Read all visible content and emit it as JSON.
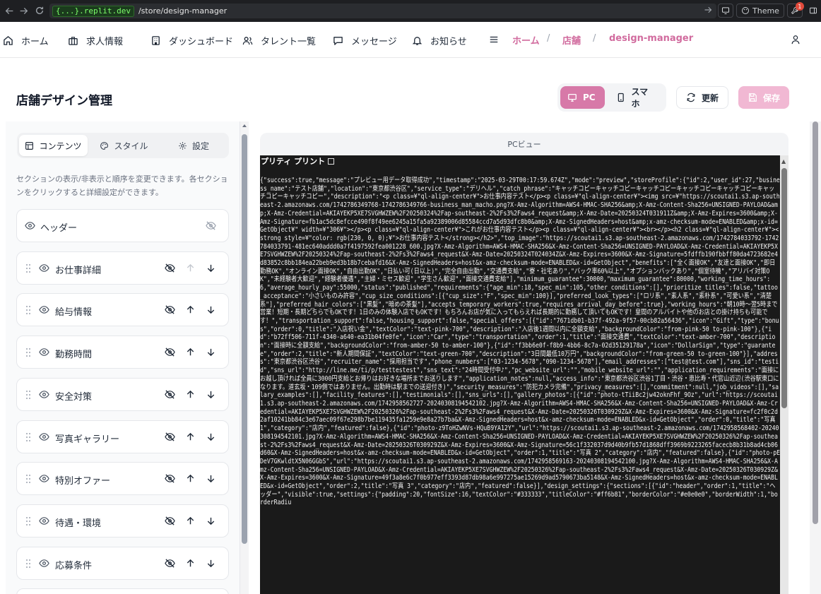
{
  "browser": {
    "replit_domain": "{...}.replit.dev",
    "path": "/store/design-manager",
    "theme_label": "Theme",
    "notification_count": "1"
  },
  "nav": {
    "items": [
      {
        "label": "ホーム",
        "icon": "home-icon"
      },
      {
        "label": "求人情報",
        "icon": "briefcase-icon"
      },
      {
        "label": "ダッシュボード",
        "icon": "building-icon"
      },
      {
        "label": "タレント一覧",
        "icon": "users-icon"
      },
      {
        "label": "メッセージ",
        "icon": "message-icon"
      },
      {
        "label": "お知らせ",
        "icon": "bell-icon"
      }
    ],
    "breadcrumb": [
      "ホーム",
      "店舗",
      "design-manager"
    ],
    "separator": "/"
  },
  "page": {
    "title": "店舗デザイン管理",
    "view_pc": "PC",
    "view_mobile": "スマホ",
    "refresh_label": "更新",
    "save_label": "保存"
  },
  "left": {
    "tabs": [
      {
        "label": "コンテンツ",
        "icon": "layout-icon",
        "active": true
      },
      {
        "label": "スタイル",
        "icon": "palette-icon",
        "active": false
      },
      {
        "label": "設定",
        "icon": "gear-icon",
        "active": false
      }
    ],
    "help": "セクションの表示/非表示と順序を変更できます。各セクションをクリックすると詳細設定ができます。",
    "sections": [
      {
        "label": "ヘッダー"
      },
      {
        "label": "お仕事詳細"
      },
      {
        "label": "給与情報"
      },
      {
        "label": "勤務時間"
      },
      {
        "label": "安全対策"
      },
      {
        "label": "写真ギャラリー"
      },
      {
        "label": "特別オファー"
      },
      {
        "label": "待遇・環境"
      },
      {
        "label": "応募条件"
      }
    ]
  },
  "preview": {
    "header": "PCビュー",
    "pretty_print": "プリティ プリント",
    "json_text": "{\"success\":true,\"message\":\"プレビュー用データ取得成功\",\"timestamp\":\"2025-03-29T00:17:59.674Z\",\"mode\":\"preview\",\"storeProfile\":{\"id\":2,\"user_id\":27,\"business_name\":\"テスト店舗\",\"location\":\"東京都渋谷区\",\"service_type\":\"デリヘル\",\"catch_phrase\":\"キャッチコピーキャッチコピーキャッチコピーキャッチコピーキャッチコピーキャッチコピーキャッチコピー\",\"description\":\"<p class=¥\"ql-align-center¥\">お仕事内容テスト</p><p class=¥\"ql-align-center¥\"><img src=¥\"https://scoutai1.s3.ap-southeast-2.amazonaws.com/1742786349768-1742786349766-business_man_macho.png?X-Amz-Algorithm=AWS4-HMAC-SHA256&amp;X-Amz-Content-Sha256=UNSIGNED-PAYLOAD&amp;X-Amz-Credential=AKIAYEKP5XE7SVGHWZEW%2F20250324%2Fap-southeast-2%2Fs3%2Faws4_request&amp;X-Amz-Date=20250324T031911Z&amp;X-Amz-Expires=3600&amp;X-Amz-Signature=fb1ac5dc8efcce490f8f49ee6245a15fa5a92389006d85584ccd7a5d93dfc8b0&amp;X-Amz-SignedHeaders=host&amp;x-amz-checksum-mode=ENABLED&amp;x-id=GetObject¥\" width=¥\"306¥\"></p><p class=¥\"ql-align-center¥\">これがお仕事内容テスト</p><p class=¥\"ql-align-center¥\"><br></p><h2 class=¥\"ql-align-center¥\"><strong style=¥\"color: rgb(230, 0, 0);¥\">お仕事内容テスト</strong></h2>\",\"top_image\":\"https://scoutai1.s3.ap-southeast-2.amazonaws.com/1742784033792-1742784033791-481ec640addd0a7f4197592fea001228_600.jpg?X-Amz-Algorithm=AWS4-HMAC-SHA256&X-Amz-Content-Sha256=UNSIGNED-PAYLOAD&X-Amz-Credential=AKIAYEKP5XE7SVGHWZEW%2F20250324%2Fap-southeast-2%2Fs3%2Faws4_request&X-Amz-Date=20250324T024034Z&X-Amz-Expires=3600&X-Amz-Signature=5fdffb190fbbff80da4723682e4d83852c8bb184ea22beb9ed3b18b7cebafd16&X-Amz-SignedHeaders=host&x-amz-checksum-mode=ENABLED&x-id=GetObject\",\"benefits\":[\"全く面接OK\",\"友達と面接OK\",\"即日勤務OK\",\"オンライン面接OK\",\"自由出勤OK\",\"日払い可(日以上)\",\"完全自由出勤\",\"交通費支給\",\"寮・社宅あり\",\"バック率60%以上\",\"オプションバックあり\",\"個室待機\",\"アリバイ対策OK\",\"未経験者大歓迎\",\"経験者優遇\",\"主婦・ミセス歓迎\",\"学生さん歓迎\",\"面接交通費支給\"],\"minimum_guarantee\":30000,\"maximum_guarantee\":80000,\"working_time_hours\":6,\"average_hourly_pay\":55000,\"status\":\"published\",\"requirements\":{\"age_min\":18,\"spec_min\":105,\"other_conditions\":[],\"prioritize_titles\":false,\"tattoo_acceptance\":\"小さいものみ許容\",\"cup_size_conditions\":[{\"cup_size\":\"F\",\"spec_min\":100}],\"preferred_look_types\":[\"ロリ系\",\"素人系\",\"素朴系\",\"可愛い系\",\"清楚系\"],\"preferred_hair_colors\":[\"黒髪\",\"暗めの茶髪\"],\"accepts_temporary_workers\":true,\"requires_arrival_day_before\":true},\"working_hours\":\"朝10時〜翌5時まで営業！短期・長期どちらでもOKです！1日のみの体験入店でもOKです！もちろんお店が気に入ってもらえれば長期的に勤務して頂いてもOKです！皇間のアルバイトや他のお店との掛け持ちも可能です！\",\"transportation_support\":false,\"housing_support\":false,\"special_offers\":[{\"id\":\"7671db01-b37f-492a-9f57-00cb82a56436\",\"icon\":\"Gift\",\"type\":\"bonus\",\"order\":0,\"title\":\"入店祝い金\",\"textColor\":\"text-pink-700\",\"description\":\"入店後1週間以内に全額支給\",\"backgroundColor\":\"from-pink-50 to-pink-100\"},{\"id\":\"b72ff506-711f-4340-a640-ea31b04fe0fe\",\"icon\":\"Car\",\"type\":\"transportation\",\"order\":1,\"title\":\"面接交通費\",\"textColor\":\"text-amber-700\",\"description\":\"面接時に全額支給\",\"backgroundColor\":\"from-amber-50 to-amber-100\"},{\"id\":\"f3bb6e0f-f8b9-4bb6-8c7a-02d35129178a\",\"icon\":\"DollarSign\",\"type\":\"guarantee\",\"order\":2,\"title\":\"新人期間保証\",\"textColor\":\"text-green-700\",\"description\":\"3日間最低10万円\",\"backgroundColor\":\"from-green-50 to-green-100\"}],\"address\":\"東京都渋谷区渋谷\",\"recruiter_name\":\"採用担当です\",\"phone_numbers\":[\"03-1234-5678\",\"090-1234-5678\"],\"email_addresses\":[\"test@test.com\"],\"sns_id\":\"testid\",\"sns_url\":\"http://line.me/ti/p/testtestest\",\"sns_text\":\"24時間受付中♪\",\"pc_website_url\":\"\",\"mobile_website_url\":\"\",\"application_requirements\":\"面接にお越し頂ければ全員に3000円支給とお帰りはお好きな場所までお送りします\",\"application_notes\":null,\"access_info\":\"東京都渋谷区渋谷1丁目・渋谷・恵比寿・代官山近辺(渋谷駅東口になります。道玄坂・109側ではありません。出勤時は駅までの送迎付き)\",\"security_measures\":\"防犯カメラ完備\",\"privacy_measures\":[],\"commitment\":null,\"job_videos\":[],\"salary_examples\":[],\"facility_features\":[],\"testimonials\":[],\"sns_urls\":[],\"gallery_photos\":[{\"id\":\"photo-tTiiBc2jw42oknFhf_9Oz\",\"url\":\"https://scoutai1.s3.ap-southeast-2.amazonaws.com/1742958562727-20240308194542102.jpg?X-Amz-Algorithm=AWS4-HMAC-SHA256&X-Amz-Content-Sha256=UNSIGNED-PAYLOAD&X-Amz-Credential=AKIAYEKP5XE7SVGHWZEW%2F20250326%2Fap-southeast-2%2Fs3%2Faws4_request&X-Amz-Date=20250326T030929Z&X-Amz-Expires=3600&X-Amz-Signature=fc2f0c2d2af10241bb84c3e67aec09f67e298b7be119435fa1259e9e8a27b7ba&X-Amz-SignedHeaders=host&x-amz-checksum-mode=ENABLED&x-id=GetObject\",\"order\":0,\"title\":\"写真 1\",\"category\":\"店内\",\"featured\":false},{\"id\":\"photo-z9ToHZwNVs-HQuB9YA12Y\",\"url\":\"https://scoutai1.s3.ap-southeast-2.amazonaws.com/1742958568402-20240308194542101.jpg?X-Amz-Algorithm=AWS4-HMAC-SHA256&X-Amz-Content-Sha256=UNSIGNED-PAYLOAD&X-Amz-Credential=AKIAYEKP5XE7SVGHWZEW%2F20250326%2Fap-southeast-2%2Fs3%2Faws4_request&X-Amz-Date=20250326T030929Z&X-Amz-Expires=3600&X-Amz-Signature=56c1f332037d9d40b9fb57d1868dff3969b9223265facecb8b31b8ad4cb06d60&X-Amz-SignedHeaders=host&x-amz-checksum-mode=ENABLED&x-id=GetObject\",\"order\":1,\"title\":\"写真 2\",\"category\":\"店内\",\"featured\":false},{\"id\":\"photo-pEDeV7GKwldtX5N06GGbS\",\"url\":\"https://scoutai1.s3.ap-southeast-2.amazonaws.com/1742958569163-20240308194542100.jpg?X-Amz-Algorithm=AWS4-HMAC-SHA256&X-Amz-Content-Sha256=UNSIGNED-PAYLOAD&X-Amz-Credential=AKIAYEKP5XE7SVGHWZEW%2F20250326%2Fap-southeast-2%2Fs3%2Faws4_request&X-Amz-Date=20250326T030929Z&X-Amz-Expires=3600&X-Amz-Signature=49f3a8e6c7f0b977eff3393d87db98a6e997275ae15269d9ad5790673ba5148&X-Amz-SignedHeaders=host&x-amz-checksum-mode=ENABLED&x-id=GetObject\",\"order\":2,\"title\":\"写真 3\",\"category\":\"店内\",\"featured\":false}],\"design_settings\":{\"sections\":[{\"id\":\"header\",\"order\":1,\"title\":\"ヘッダー\",\"visible\":true,\"settings\":{\"padding\":20,\"fontSize\":16,\"textColor\":\"#333333\",\"titleColor\":\"#ff6b81\",\"borderColor\":\"#e0e0e0\",\"borderWidth\":1,\"borderRadiu"
  }
}
